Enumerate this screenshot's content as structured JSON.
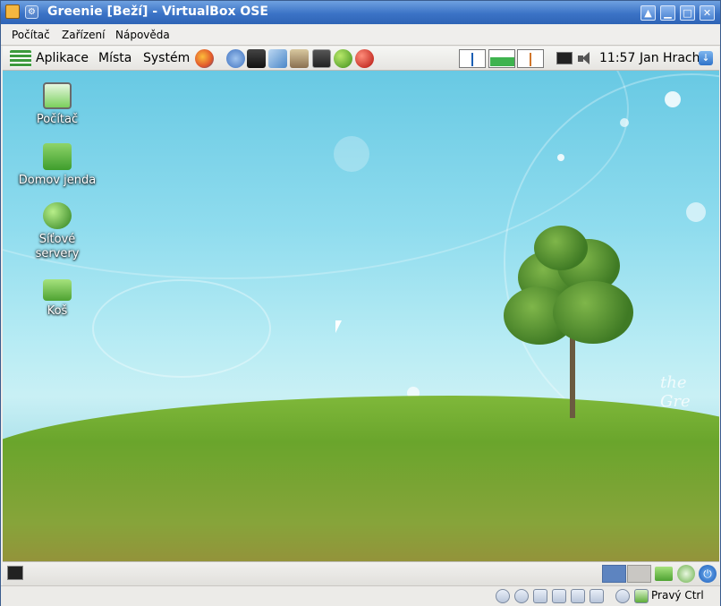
{
  "window": {
    "title": "Greenie [Beží] - VirtualBox OSE",
    "controls": [
      "up",
      "minimize",
      "maximize",
      "close"
    ]
  },
  "menubar": {
    "items": [
      {
        "label": "Počítač"
      },
      {
        "label": "Zařízení"
      },
      {
        "label": "Nápověda"
      }
    ]
  },
  "guest_panel": {
    "menus": [
      {
        "label": "Aplikace"
      },
      {
        "label": "Místa"
      },
      {
        "label": "Systém"
      }
    ],
    "launchers": [
      "firefox-icon",
      "pidgin-icon",
      "movie-player-icon",
      "text-editor-icon",
      "package-manager-icon",
      "terminal-icon",
      "green-apple-icon",
      "red-apple-icon"
    ],
    "clock": "11:57",
    "user": "Jan Hrach"
  },
  "desktop": {
    "icons": [
      {
        "label": "Počítač",
        "icon": "computer-icon"
      },
      {
        "label": "Domov jenda",
        "icon": "home-folder-icon"
      },
      {
        "label": "Síťové servery",
        "icon": "network-icon"
      },
      {
        "label": "Koš",
        "icon": "trash-icon"
      }
    ],
    "watermark": "the Gre"
  },
  "statusbar": {
    "host_key": "Pravý Ctrl"
  }
}
